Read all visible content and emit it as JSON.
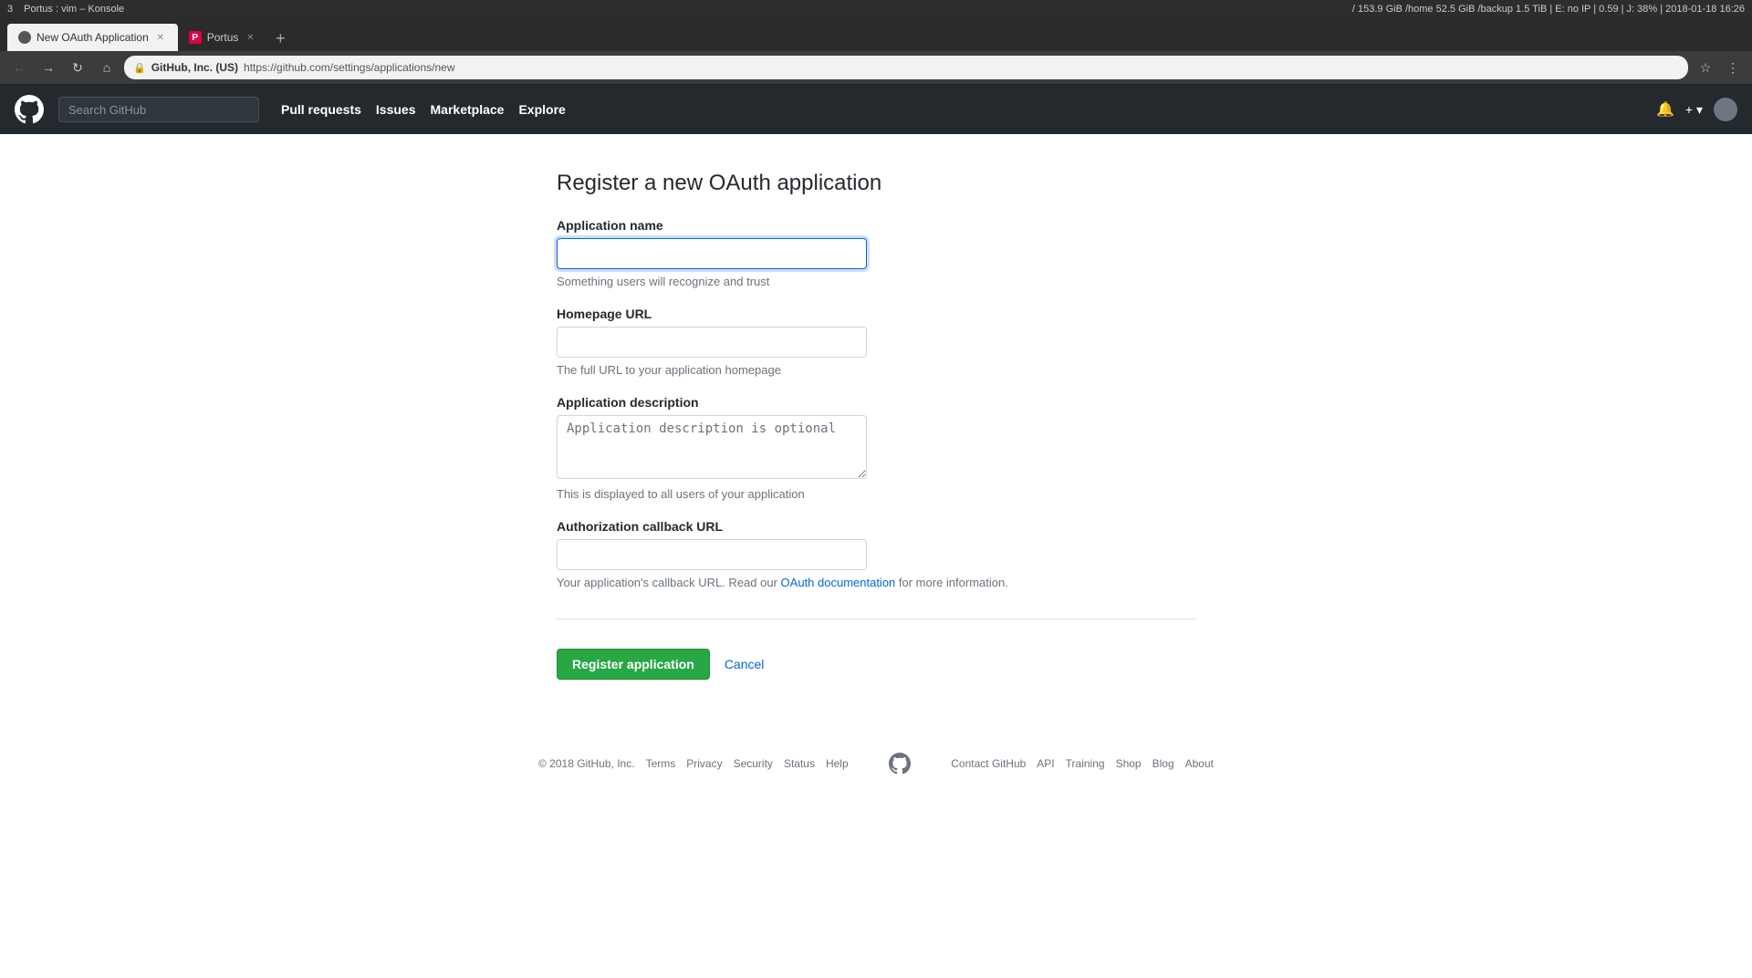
{
  "os_bar": {
    "left": "3",
    "center": "Portus : vim – Konsole",
    "right": "/ 153.9 GiB /home 52.5 GiB /backup 1.5 TiB | E: no IP | 0.59 | J: 38% | 2018-01-18 16:26"
  },
  "browser": {
    "tabs": [
      {
        "id": "tab1",
        "label": "New OAuth Application",
        "favicon": "🔒",
        "active": true
      },
      {
        "id": "tab2",
        "label": "Portus",
        "favicon": "P",
        "active": false
      }
    ],
    "address": {
      "lock_label": "GitHub, Inc. (US)",
      "url": "https://github.com/settings/applications/new"
    }
  },
  "github_header": {
    "search_placeholder": "Search GitHub",
    "nav": [
      "Pull requests",
      "Issues",
      "Marketplace",
      "Explore"
    ]
  },
  "page": {
    "title": "Register a new OAuth application",
    "form": {
      "app_name_label": "Application name",
      "app_name_help": "Something users will recognize and trust",
      "homepage_url_label": "Homepage URL",
      "homepage_url_help": "The full URL to your application homepage",
      "app_desc_label": "Application description",
      "app_desc_placeholder": "Application description is optional",
      "app_desc_help": "This is displayed to all users of your application",
      "callback_url_label": "Authorization callback URL",
      "callback_url_help_prefix": "Your application's callback URL. Read our ",
      "callback_url_link_text": "OAuth documentation",
      "callback_url_help_suffix": " for more information.",
      "register_btn": "Register application",
      "cancel_btn": "Cancel"
    }
  },
  "footer": {
    "copyright": "© 2018 GitHub, Inc.",
    "links_left": [
      "Terms",
      "Privacy",
      "Security",
      "Status",
      "Help"
    ],
    "links_right": [
      "Contact GitHub",
      "API",
      "Training",
      "Shop",
      "Blog",
      "About"
    ]
  }
}
